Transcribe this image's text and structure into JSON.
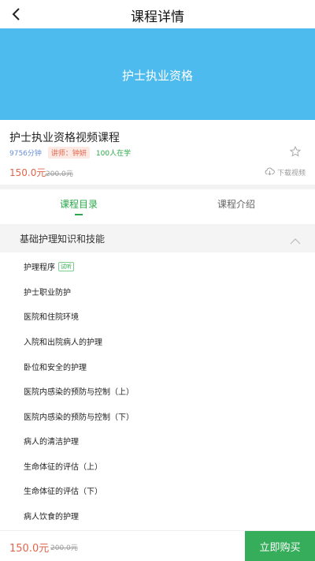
{
  "header": {
    "title": "课程详情"
  },
  "banner": {
    "title": "护士执业资格",
    "color": "#4dbbee"
  },
  "course": {
    "title": "护士执业资格视频课程",
    "duration": "9756分钟",
    "teacher": "讲师：钟妍",
    "students": "100人在学",
    "price": "150.0元",
    "original_price": "200.0元",
    "download_label": "下载视频"
  },
  "tabs": [
    {
      "label": "课程目录",
      "active": true
    },
    {
      "label": "课程介绍",
      "active": false
    }
  ],
  "section": {
    "title": "基础护理知识和技能"
  },
  "lessons": [
    {
      "title": "护理程序",
      "badge": "试听"
    },
    {
      "title": "护士职业防护"
    },
    {
      "title": "医院和住院环境"
    },
    {
      "title": "入院和出院病人的护理"
    },
    {
      "title": "卧位和安全的护理"
    },
    {
      "title": "医院内感染的预防与控制（上）"
    },
    {
      "title": "医院内感染的预防与控制（下）"
    },
    {
      "title": "病人的清洁护理"
    },
    {
      "title": "生命体征的评估（上）"
    },
    {
      "title": "生命体征的评估（下）"
    },
    {
      "title": "病人饮食的护理"
    }
  ],
  "footer": {
    "price": "150.0元",
    "original_price": "200.0元",
    "buy_label": "立即购买"
  },
  "colors": {
    "accent": "#2aa84a",
    "price": "#e0664d",
    "buy_button": "#35ad5a"
  }
}
